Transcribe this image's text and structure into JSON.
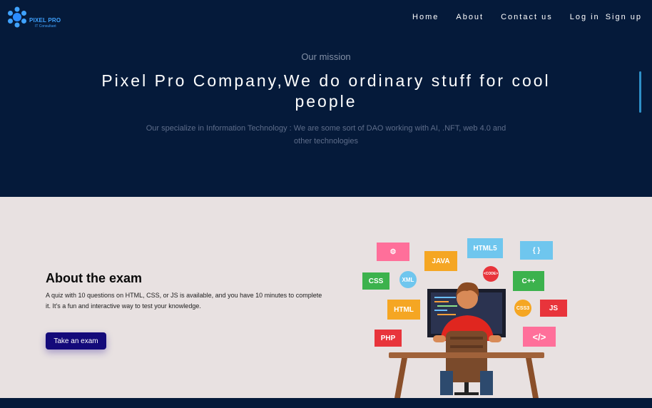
{
  "brand": {
    "name": "PIXEL PRO",
    "tagline": "IT Consultant"
  },
  "nav": {
    "home": "Home",
    "about": "About",
    "contact": "Contact us",
    "login": "Log in",
    "signup": "Sign up"
  },
  "hero": {
    "eyebrow": "Our mission",
    "headline": "Pixel Pro Company,We do ordinary stuff for cool people",
    "description": "Our specialize in Information Technology : We are some sort of DAO working with AI, .NFT, web 4.0 and other technologies"
  },
  "about": {
    "title": "About the exam",
    "text": "A quiz with 10 questions on HTML, CSS, or JS is available, and you have 10 minutes to complete it. It's a fun and interactive way to test your knowledge.",
    "button": "Take an exam"
  },
  "illustration": {
    "tags": {
      "html5": "HTML5",
      "braces": "{ }",
      "java": "JAVA",
      "code": "<CODE>",
      "css": "CSS",
      "xml": "XML",
      "cpp": "C++",
      "html": "HTML",
      "css3": "CSS3",
      "js": "JS",
      "php": "PHP",
      "slash": "</>"
    }
  },
  "colors": {
    "hero_bg": "#051a3a",
    "section_bg": "#e8e1e1",
    "button": "#140a7a",
    "brand": "#3fa2ff"
  }
}
